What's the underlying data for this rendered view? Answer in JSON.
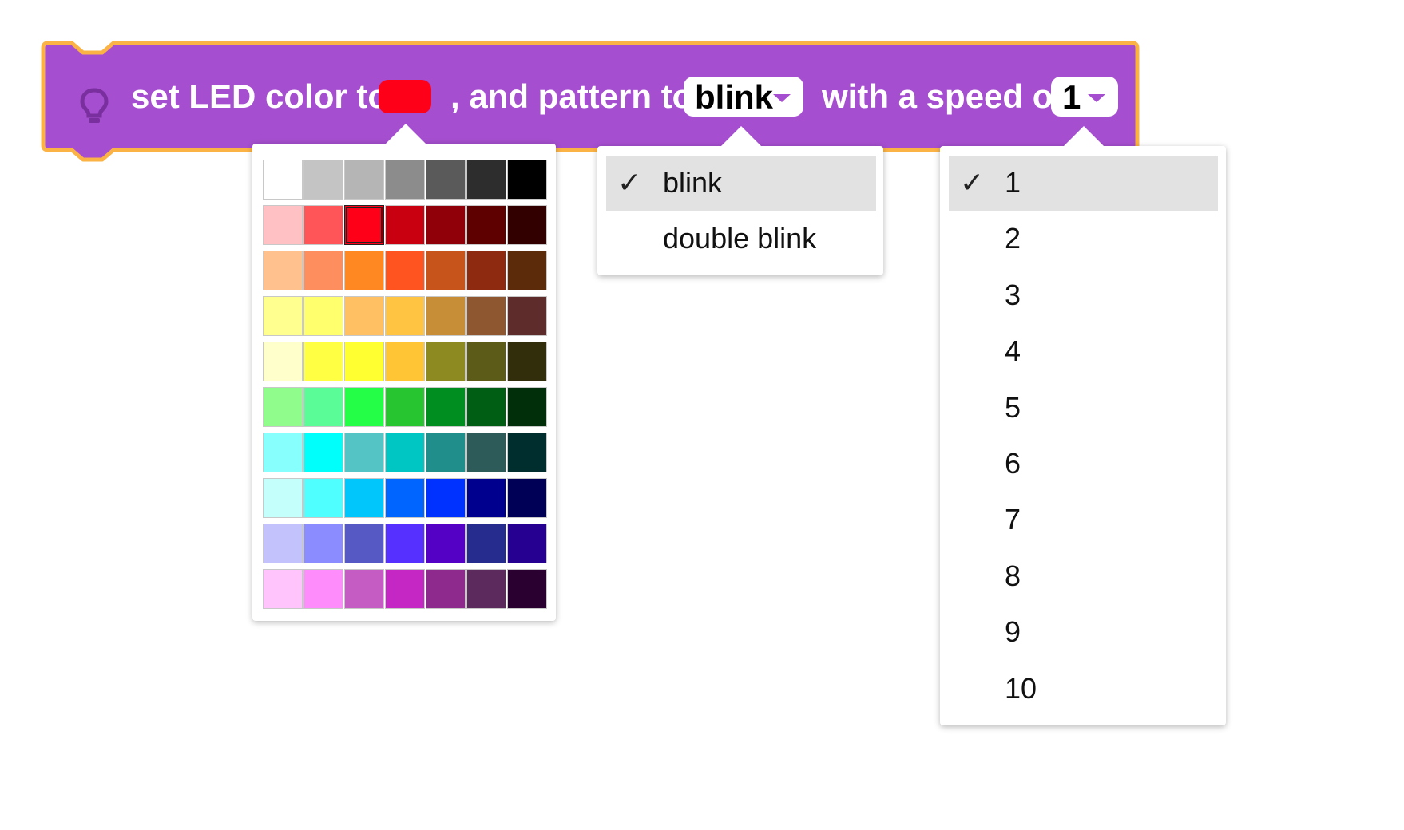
{
  "block": {
    "icon": "lightbulb-icon",
    "text_before_color": "set LED color to",
    "text_before_pattern": ", and pattern to",
    "text_before_speed": "with a speed of",
    "fill_color": "#a54ecf",
    "outline_color": "#fbb346",
    "selected_color": "#ff0019",
    "pattern_value": "blink",
    "speed_value": "1"
  },
  "color_picker": {
    "selected_row": 1,
    "selected_col": 2,
    "rows": [
      [
        "#ffffff",
        "#c4c4c4",
        "#b5b5b5",
        "#8c8c8c",
        "#5a5a5a",
        "#2d2d2d",
        "#000000"
      ],
      [
        "#ffc1c4",
        "#ff5458",
        "#ff0019",
        "#c8000f",
        "#900008",
        "#5e0000",
        "#330000"
      ],
      [
        "#ffc28f",
        "#ff8e5f",
        "#ff8822",
        "#ff5420",
        "#c7541b",
        "#8e2a0f",
        "#5b2b0a"
      ],
      [
        "#ffff8f",
        "#ffff6e",
        "#ffc064",
        "#ffc441",
        "#c88e37",
        "#8e572f",
        "#5e2d2b"
      ],
      [
        "#ffffcc",
        "#ffff43",
        "#ffff32",
        "#ffc534",
        "#8e8a22",
        "#5c5b18",
        "#322d0a"
      ],
      [
        "#8ffc8c",
        "#5afc97",
        "#25fe47",
        "#27c530",
        "#008e20",
        "#005d14",
        "#002f0a"
      ],
      [
        "#86fffd",
        "#00fffb",
        "#54c4c4",
        "#00c6c3",
        "#208e8a",
        "#2c5b59",
        "#002d2d"
      ],
      [
        "#c4fffc",
        "#4fffff",
        "#00c6fb",
        "#0064ff",
        "#0032ff",
        "#00008f",
        "#000057"
      ],
      [
        "#c4c2fd",
        "#8a8cff",
        "#5658c4",
        "#5630ff",
        "#5500c5",
        "#262c8d",
        "#260090"
      ],
      [
        "#ffc4fc",
        "#ff8cfb",
        "#c45cc4",
        "#c427c3",
        "#8e298e",
        "#5c2a5c",
        "#2a0030"
      ]
    ]
  },
  "pattern_menu": {
    "check_mark": "✓",
    "items": [
      {
        "label": "blink"
      },
      {
        "label": "double blink"
      }
    ]
  },
  "speed_menu": {
    "check_mark": "✓",
    "items": [
      {
        "label": "1"
      },
      {
        "label": "2"
      },
      {
        "label": "3"
      },
      {
        "label": "4"
      },
      {
        "label": "5"
      },
      {
        "label": "6"
      },
      {
        "label": "7"
      },
      {
        "label": "8"
      },
      {
        "label": "9"
      },
      {
        "label": "10"
      }
    ]
  }
}
